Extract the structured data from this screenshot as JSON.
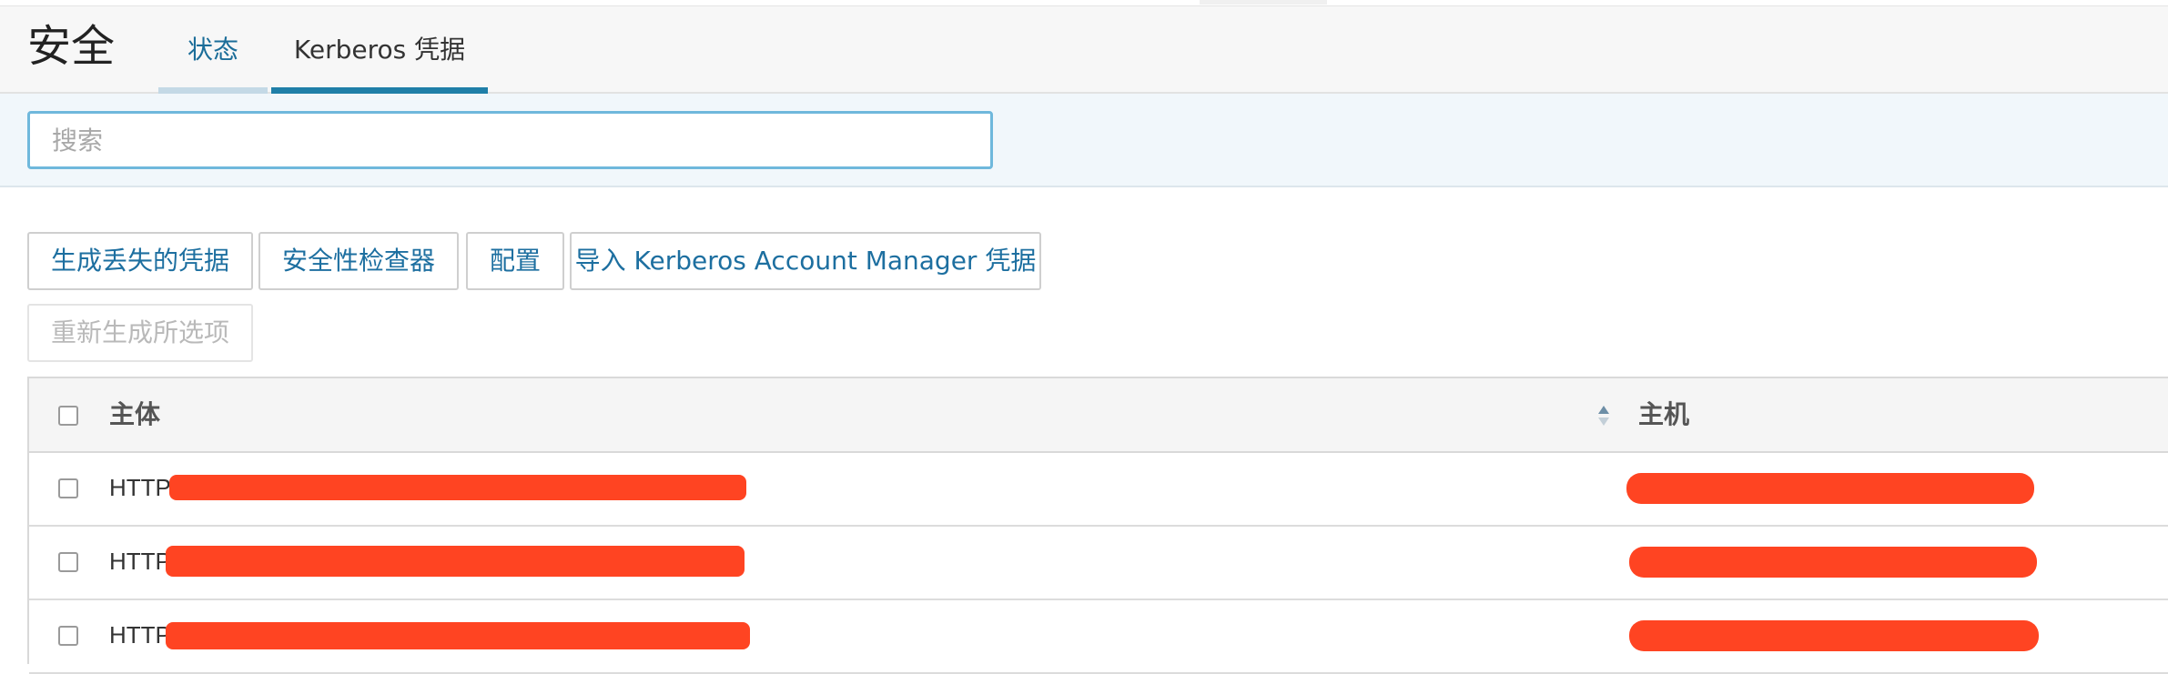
{
  "header": {
    "title": "安全",
    "tabs": [
      {
        "label": "状态",
        "active": false
      },
      {
        "label": "Kerberos 凭据",
        "active": true
      }
    ]
  },
  "search": {
    "placeholder": "搜索",
    "value": ""
  },
  "toolbar": {
    "generate_missing_label": "生成丢失的凭据",
    "security_inspector_label": "安全性检查器",
    "config_label": "配置",
    "import_kam_label": "导入 Kerberos Account Manager 凭据",
    "regenerate_selected_label": "重新生成所选项",
    "regenerate_selected_disabled": true
  },
  "table": {
    "columns": [
      "主体",
      "主机"
    ],
    "rows": [
      {
        "principal": "HTTP",
        "host": ""
      },
      {
        "principal": "HTTP",
        "host": ""
      },
      {
        "principal": "HTTP",
        "host": ""
      }
    ]
  },
  "colors": {
    "accent": "#1f7fa8",
    "link": "#1d6fa0",
    "redaction": "#ff4422",
    "search_band_bg": "#f1f7fb"
  },
  "icons": {
    "sort": "sort-icon"
  }
}
